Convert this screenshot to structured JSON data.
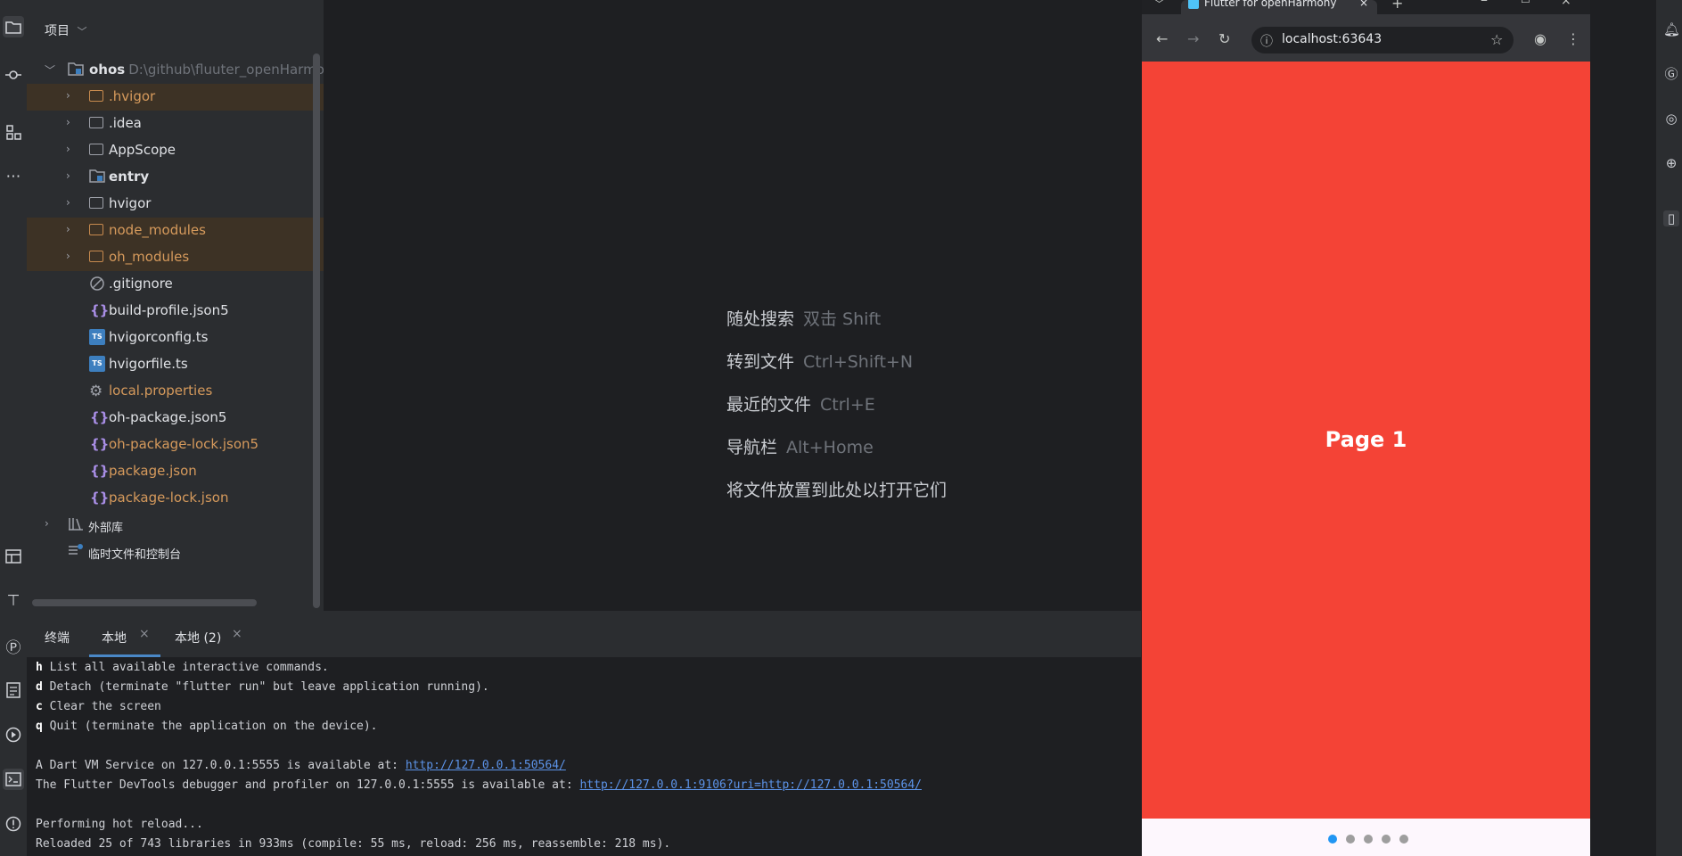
{
  "project_panel": {
    "title": "项目",
    "root": {
      "name": "ohos",
      "path": "D:\\github\\fluuter_openHarmony\\"
    },
    "items": [
      {
        "label": ".hvigor",
        "type": "folder",
        "excluded": true
      },
      {
        "label": ".idea",
        "type": "folder",
        "excluded": false
      },
      {
        "label": "AppScope",
        "type": "folder",
        "excluded": false
      },
      {
        "label": "entry",
        "type": "module",
        "excluded": false
      },
      {
        "label": "hvigor",
        "type": "folder",
        "excluded": false
      },
      {
        "label": "node_modules",
        "type": "folder",
        "excluded": true
      },
      {
        "label": "oh_modules",
        "type": "folder",
        "excluded": true
      },
      {
        "label": ".gitignore",
        "type": "ignore-file",
        "excluded": false
      },
      {
        "label": "build-profile.json5",
        "type": "json",
        "excluded": false
      },
      {
        "label": "hvigorconfig.ts",
        "type": "ts",
        "excluded": false
      },
      {
        "label": "hvigorfile.ts",
        "type": "ts",
        "excluded": false
      },
      {
        "label": "local.properties",
        "type": "settings",
        "excluded": true
      },
      {
        "label": "oh-package.json5",
        "type": "json",
        "excluded": false
      },
      {
        "label": "oh-package-lock.json5",
        "type": "json",
        "excluded": true
      },
      {
        "label": "package.json",
        "type": "json",
        "excluded": true
      },
      {
        "label": "package-lock.json",
        "type": "json",
        "excluded": true
      }
    ],
    "external_libs": "外部库",
    "scratches": "临时文件和控制台"
  },
  "editor": {
    "hints": [
      {
        "action": "随处搜索",
        "key": "双击 Shift"
      },
      {
        "action": "转到文件",
        "key": "Ctrl+Shift+N"
      },
      {
        "action": "最近的文件",
        "key": "Ctrl+E"
      },
      {
        "action": "导航栏",
        "key": "Alt+Home"
      },
      {
        "action": "将文件放置到此处以打开它们",
        "key": ""
      }
    ]
  },
  "terminal": {
    "title": "终端",
    "tabs": [
      {
        "label": "本地"
      },
      {
        "label": "本地 (2)"
      }
    ],
    "lines": [
      {
        "key": "h",
        "text": " List all available interactive commands."
      },
      {
        "key": "d",
        "text": " Detach (terminate \"flutter run\" but leave application running)."
      },
      {
        "key": "c",
        "text": " Clear the screen"
      },
      {
        "key": "q",
        "text": " Quit (terminate the application on the device)."
      },
      {
        "key": "",
        "text": ""
      },
      {
        "key": "",
        "text": "A Dart VM Service on 127.0.0.1:5555 is available at: ",
        "link": "http://127.0.0.1:50564/"
      },
      {
        "key": "",
        "text": "The Flutter DevTools debugger and profiler on 127.0.0.1:5555 is available at: ",
        "link": "http://127.0.0.1:9106?uri=http://127.0.0.1:50564/"
      },
      {
        "key": "",
        "text": ""
      },
      {
        "key": "",
        "text": "Performing hot reload..."
      },
      {
        "key": "",
        "text": "Reloaded 25 of 743 libraries in 933ms (compile: 55 ms, reload: 256 ms, reassemble: 218 ms)."
      }
    ]
  },
  "browser": {
    "tab_title": "Flutter for openHarmony",
    "address": "localhost:63643",
    "page": {
      "title": "Page 1",
      "background": "#f44336",
      "dots_total": 5,
      "dots_active": 0
    }
  },
  "colors": {
    "accent": "#4a88c7",
    "link": "#5c93e8",
    "excluded": "#d69a5c"
  }
}
